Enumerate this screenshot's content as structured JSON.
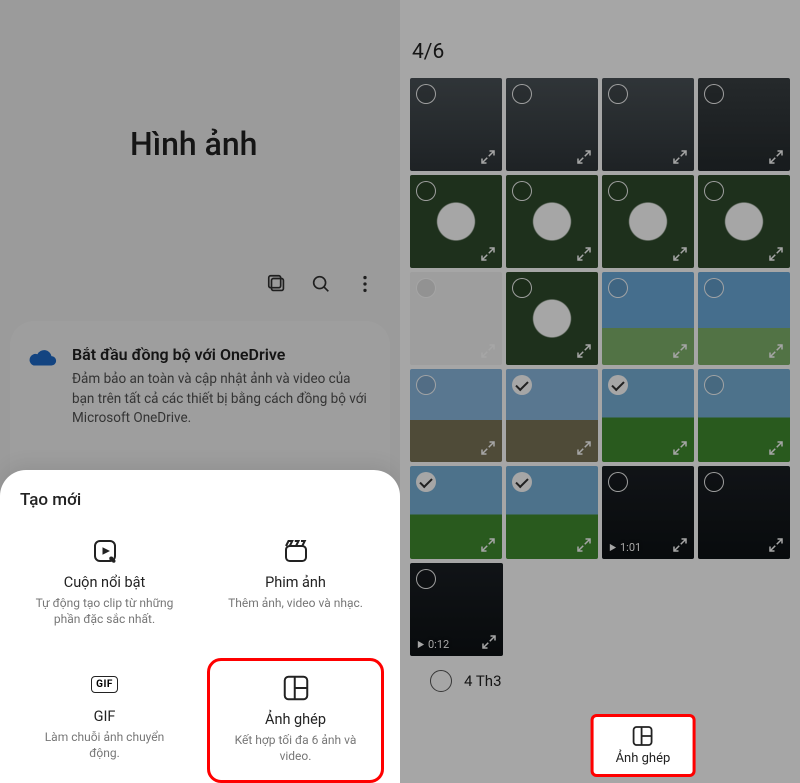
{
  "left": {
    "title": "Hình ảnh",
    "toolbar": {
      "multi_icon": "multi-select-icon",
      "search_icon": "search-icon",
      "more_icon": "more-icon"
    },
    "onedrive": {
      "title": "Bắt đầu đồng bộ với OneDrive",
      "desc": "Đảm bảo an toàn và cập nhật ảnh và video của bạn trên tất cả các thiết bị bằng cách đồng bộ với Microsoft OneDrive."
    },
    "create": {
      "heading": "Tạo mới",
      "items": [
        {
          "icon": "play-sparkle-icon",
          "title": "Cuộn nổi bật",
          "desc": "Tự động tạo clip từ những phần đặc sắc nhất."
        },
        {
          "icon": "clapper-icon",
          "title": "Phim ảnh",
          "desc": "Thêm ảnh, video và nhạc."
        },
        {
          "icon": "gif-icon",
          "title": "GIF",
          "desc": "Làm chuỗi ảnh chuyển động."
        },
        {
          "icon": "collage-icon",
          "title": "Ảnh ghép",
          "desc": "Kết hợp tối đa 6 ảnh và video.",
          "highlight": true
        }
      ]
    }
  },
  "right": {
    "counter": "4/6",
    "date_section": "4 Th3",
    "bottom_button": {
      "label": "Ảnh ghép"
    },
    "grid": [
      [
        {
          "t": "indoor",
          "sel": false
        },
        {
          "t": "indoor",
          "sel": false
        },
        {
          "t": "indoor",
          "sel": false
        },
        {
          "t": "indoor2",
          "sel": false
        }
      ],
      [
        {
          "t": "flower",
          "sel": false
        },
        {
          "t": "flower",
          "sel": false
        },
        {
          "t": "flower",
          "sel": false
        },
        {
          "t": "flower",
          "sel": false
        }
      ],
      [
        {
          "t": "screenshot",
          "sel": false
        },
        {
          "t": "flower",
          "sel": false
        },
        {
          "t": "sky",
          "sel": false
        },
        {
          "t": "sky",
          "sel": false
        }
      ],
      [
        {
          "t": "road",
          "sel": false
        },
        {
          "t": "road",
          "sel": true
        },
        {
          "t": "green",
          "sel": true
        },
        {
          "t": "green",
          "sel": false
        }
      ],
      [
        {
          "t": "green",
          "sel": true
        },
        {
          "t": "green",
          "sel": true
        },
        {
          "t": "dark",
          "sel": false,
          "dur": "1:01"
        },
        {
          "t": "dark",
          "sel": false
        }
      ],
      [
        {
          "t": "dark",
          "sel": false,
          "dur": "0:12"
        }
      ]
    ]
  }
}
